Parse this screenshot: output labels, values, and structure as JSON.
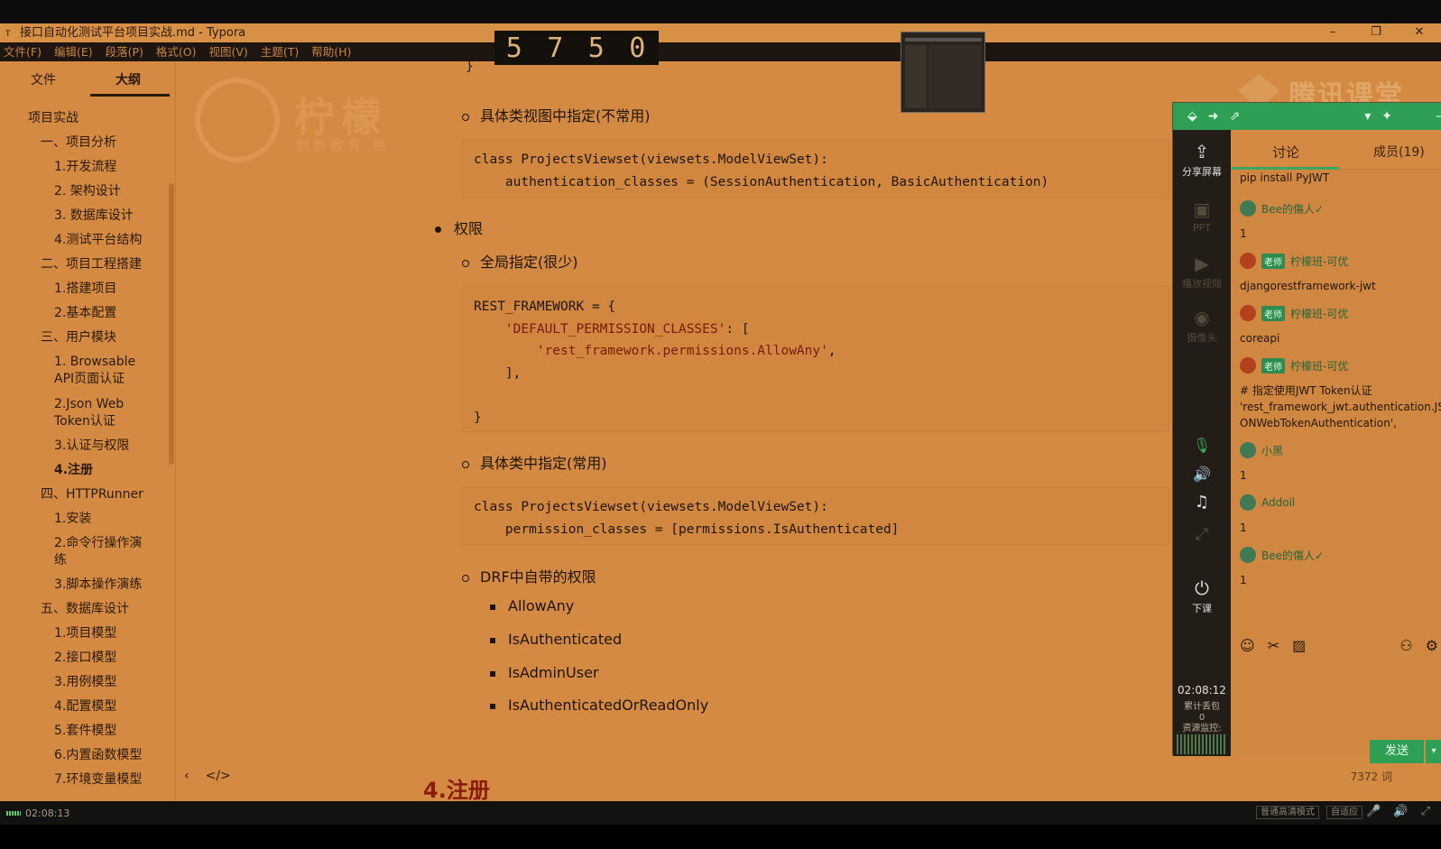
{
  "window": {
    "title": "接口自动化测试平台项目实战.md - Typora",
    "app_icon": "T",
    "controls": [
      "–",
      "❐",
      "✕"
    ]
  },
  "menu": [
    "文件(F)",
    "编辑(E)",
    "段落(P)",
    "格式(O)",
    "视图(V)",
    "主题(T)",
    "帮助(H)"
  ],
  "counter_digits": [
    "5",
    "7",
    "5",
    "0"
  ],
  "sidebar": {
    "tab_files": "文件",
    "tab_outline": "大纲",
    "outline": [
      "项目实战",
      "一、项目分析",
      "1.开发流程",
      "2. 架构设计",
      "3. 数据库设计",
      "4.测试平台结构",
      "二、项目工程搭建",
      "1.搭建项目",
      "2.基本配置",
      "三、用户模块",
      "1. Browsable\nAPI页面认证",
      "2.Json Web\nToken认证",
      "3.认证与权限",
      "4.注册",
      "四、HTTPRunner",
      "1.安装",
      "2.命令行操作演\n练",
      "3.脚本操作演练",
      "五、数据库设计",
      "1.项目模型",
      "2.接口模型",
      "3.用例模型",
      "4.配置模型",
      "5.套件模型",
      "6.内置函数模型",
      "7.环境变量模型"
    ]
  },
  "logo": {
    "cn": "柠檬",
    "sub": "创新教育 栝"
  },
  "content": {
    "brace_top": "}",
    "item_view_specific": "具体类视图中指定(不常用)",
    "code1_line1_kw": "class",
    "code1_line1": " ProjectsViewset(viewsets.ModelViewSet):",
    "code1_line2": "    authentication_classes = (SessionAuthentication, BasicAuthentication)",
    "bullet_permissions": "权限",
    "item_global": "全局指定(很少)",
    "code2_l1": "REST_FRAMEWORK = {",
    "code2_l2": "'DEFAULT_PERMISSION_CLASSES'",
    "code2_l2b": ": [",
    "code2_l3": "'rest_framework.permissions.AllowAny'",
    "code2_l3b": ",",
    "code2_l4": "    ],",
    "code2_l5": "}",
    "item_class_specific": "具体类中指定(常用)",
    "code3_line1_kw": "class",
    "code3_line1": " ProjectsViewset(viewsets.ModelViewSet):",
    "code3_line2": "    permission_classes = [permissions.IsAuthenticated]",
    "item_drf": "DRF中自带的权限",
    "perms": [
      "AllowAny",
      "IsAuthenticated",
      "IsAdminUser",
      "IsAuthenticatedOrReadOnly"
    ],
    "heading_partial": "4.注册",
    "nav_back": "‹",
    "nav_source": "</>",
    "word_count": "7372 词"
  },
  "watermark": "腾讯课堂",
  "classroom": {
    "tools": [
      {
        "icon": "⇪",
        "label": "分享屏幕"
      },
      {
        "icon": "▣",
        "label": "PPT"
      },
      {
        "icon": "▶",
        "label": "播放视频"
      },
      {
        "icon": "◉",
        "label": "摄像头"
      }
    ],
    "mic_icon": "🎙",
    "speaker_icon": "🔊",
    "music_icon": "♫",
    "expand_icon": "⤢",
    "end_icon": "⏻",
    "end_label": "下课",
    "time": "02:08:12",
    "stats": "累计丢包\n0\n资源监控:",
    "tab_discuss": "讨论",
    "tab_members": "成员(19)",
    "messages": [
      {
        "type": "text",
        "text": "pip install PyJWT"
      },
      {
        "type": "user",
        "name": "Bee的傷人✓",
        "teacher": false
      },
      {
        "type": "text",
        "text": "1"
      },
      {
        "type": "user",
        "name": "柠檬班-可优",
        "teacher": true
      },
      {
        "type": "text",
        "text": "djangorestframework-jwt"
      },
      {
        "type": "user",
        "name": "柠檬班-可优",
        "teacher": true
      },
      {
        "type": "text",
        "text": "coreapi"
      },
      {
        "type": "user",
        "name": "柠檬班-可优",
        "teacher": true
      },
      {
        "type": "text",
        "text": "# 指定使用JWT Token认证\n    'rest_framework_jwt.authentication.JS\nONWebTokenAuthentication',"
      },
      {
        "type": "user",
        "name": "小黑",
        "teacher": false
      },
      {
        "type": "text",
        "text": "1"
      },
      {
        "type": "user",
        "name": "Addoil",
        "teacher": false
      },
      {
        "type": "text",
        "text": "1"
      },
      {
        "type": "user",
        "name": "Bee的傷人✓",
        "teacher": false
      },
      {
        "type": "text",
        "text": "1"
      }
    ],
    "teacher_badge": "老师",
    "send": "发送"
  },
  "bottom": {
    "time": "02:08:13",
    "btn_hd": "普通高清模式",
    "btn_adapt": "自适应"
  }
}
